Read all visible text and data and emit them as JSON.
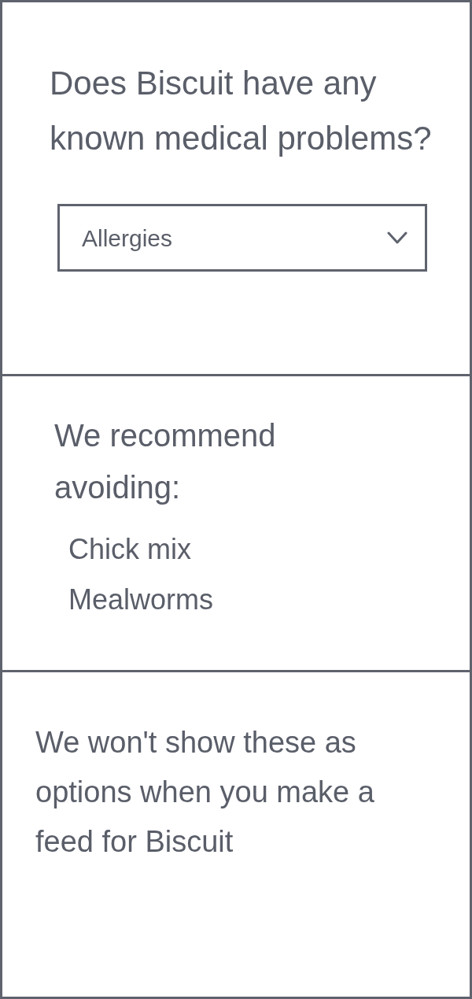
{
  "question": {
    "text": "Does Biscuit have any known medical problems?"
  },
  "condition_select": {
    "value": "Allergies"
  },
  "recommendation": {
    "heading": "We recommend avoiding:",
    "items": [
      "Chick mix",
      "Mealworms"
    ]
  },
  "note": {
    "text": "We won't show these as options when you make a feed for Biscuit"
  }
}
